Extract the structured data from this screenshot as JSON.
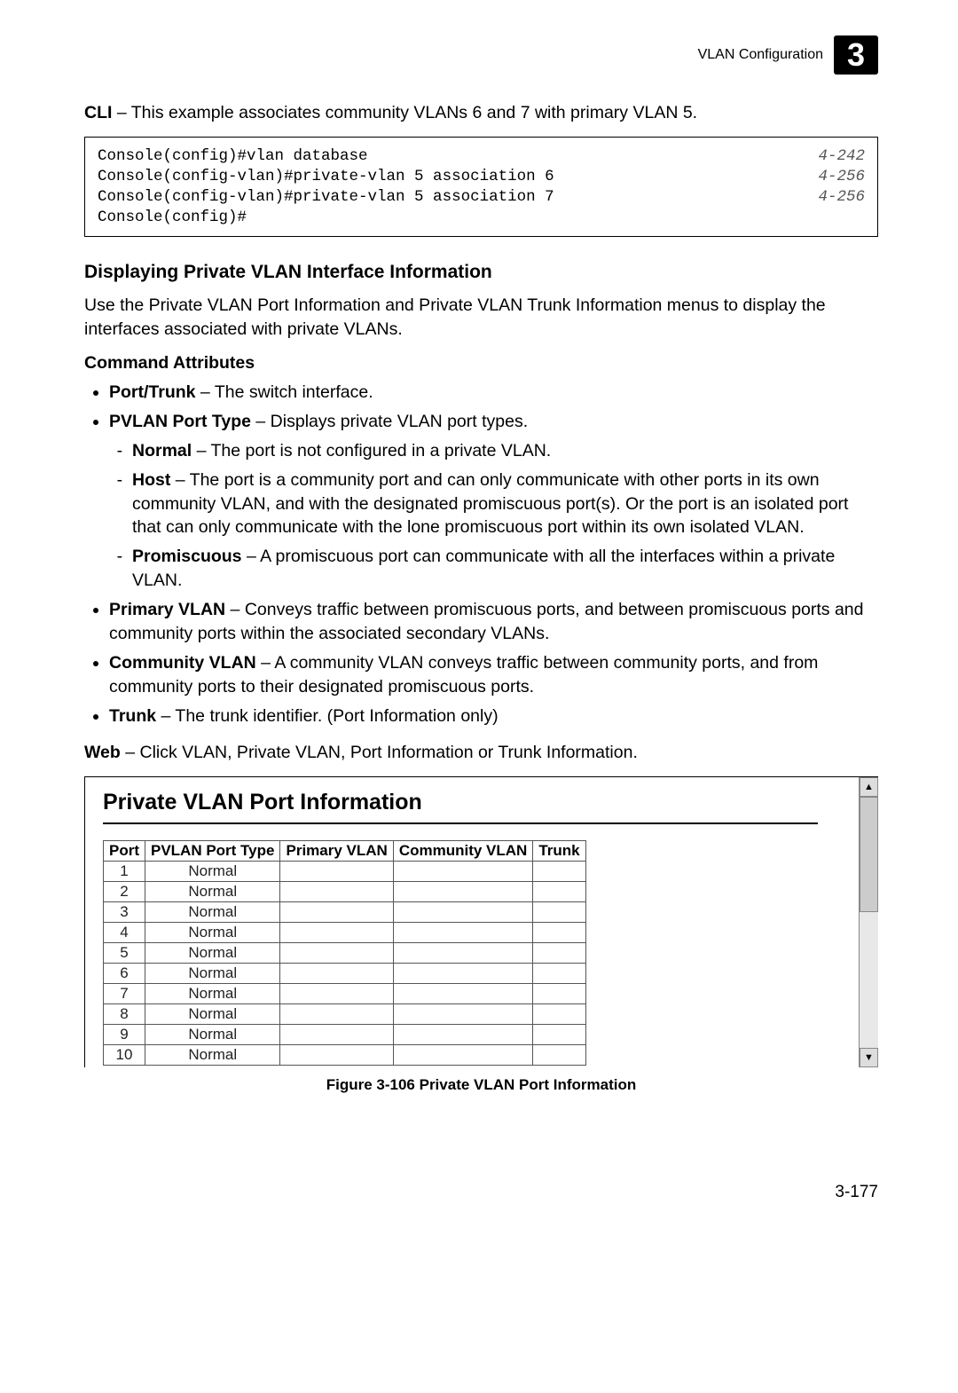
{
  "header": {
    "section_title": "VLAN Configuration",
    "chapter_number": "3"
  },
  "intro_cli": {
    "label": "CLI",
    "text": " – This example associates community VLANs 6 and 7 with primary VLAN 5."
  },
  "console": {
    "lines": [
      {
        "cmd": "Console(config)#vlan database",
        "ref": "4-242"
      },
      {
        "cmd": "Console(config-vlan)#private-vlan 5 association 6",
        "ref": "4-256"
      },
      {
        "cmd": "Console(config-vlan)#private-vlan 5 association 7",
        "ref": "4-256"
      },
      {
        "cmd": "Console(config)#",
        "ref": ""
      }
    ]
  },
  "section_heading": "Displaying Private VLAN Interface Information",
  "section_para": "Use the Private VLAN Port Information and Private VLAN Trunk Information menus to display the interfaces associated with private VLANs.",
  "cmd_attr_heading": "Command Attributes",
  "bullets": {
    "port_trunk": {
      "label": "Port/Trunk",
      "text": " – The switch interface."
    },
    "pvlan_port_type": {
      "label": "PVLAN Port Type",
      "text": " – Displays private VLAN port types.",
      "sub": {
        "normal": {
          "label": "Normal",
          "text": " – The port is not configured in a private VLAN."
        },
        "host": {
          "label": "Host",
          "text": " – The port is a community port and can only communicate with other ports in its own community VLAN, and with the designated promiscuous port(s). Or the port is an isolated port that can only communicate with the lone promiscuous port within its own isolated VLAN."
        },
        "promiscuous": {
          "label": "Promiscuous",
          "text": " – A promiscuous port can communicate with all the interfaces within a private VLAN."
        }
      }
    },
    "primary_vlan": {
      "label": "Primary VLAN",
      "text": " – Conveys traffic between promiscuous ports, and between promiscuous ports and community ports within the associated secondary VLANs."
    },
    "community_vlan": {
      "label": "Community VLAN",
      "text": " – A community VLAN conveys traffic between community ports, and from community ports to their designated promiscuous ports."
    },
    "trunk": {
      "label": "Trunk",
      "text": " – The trunk identifier. (Port Information only)"
    }
  },
  "web_para": {
    "label": "Web",
    "text": " – Click VLAN, Private VLAN, Port Information or Trunk Information."
  },
  "screenshot": {
    "title": "Private VLAN Port Information",
    "columns": [
      "Port",
      "PVLAN Port Type",
      "Primary VLAN",
      "Community VLAN",
      "Trunk"
    ],
    "rows": [
      {
        "port": "1",
        "type": "Normal",
        "primary": "",
        "community": "",
        "trunk": ""
      },
      {
        "port": "2",
        "type": "Normal",
        "primary": "",
        "community": "",
        "trunk": ""
      },
      {
        "port": "3",
        "type": "Normal",
        "primary": "",
        "community": "",
        "trunk": ""
      },
      {
        "port": "4",
        "type": "Normal",
        "primary": "",
        "community": "",
        "trunk": ""
      },
      {
        "port": "5",
        "type": "Normal",
        "primary": "",
        "community": "",
        "trunk": ""
      },
      {
        "port": "6",
        "type": "Normal",
        "primary": "",
        "community": "",
        "trunk": ""
      },
      {
        "port": "7",
        "type": "Normal",
        "primary": "",
        "community": "",
        "trunk": ""
      },
      {
        "port": "8",
        "type": "Normal",
        "primary": "",
        "community": "",
        "trunk": ""
      },
      {
        "port": "9",
        "type": "Normal",
        "primary": "",
        "community": "",
        "trunk": ""
      },
      {
        "port": "10",
        "type": "Normal",
        "primary": "",
        "community": "",
        "trunk": ""
      }
    ]
  },
  "figure_caption": "Figure 3-106  Private VLAN Port Information",
  "page_number": "3-177"
}
